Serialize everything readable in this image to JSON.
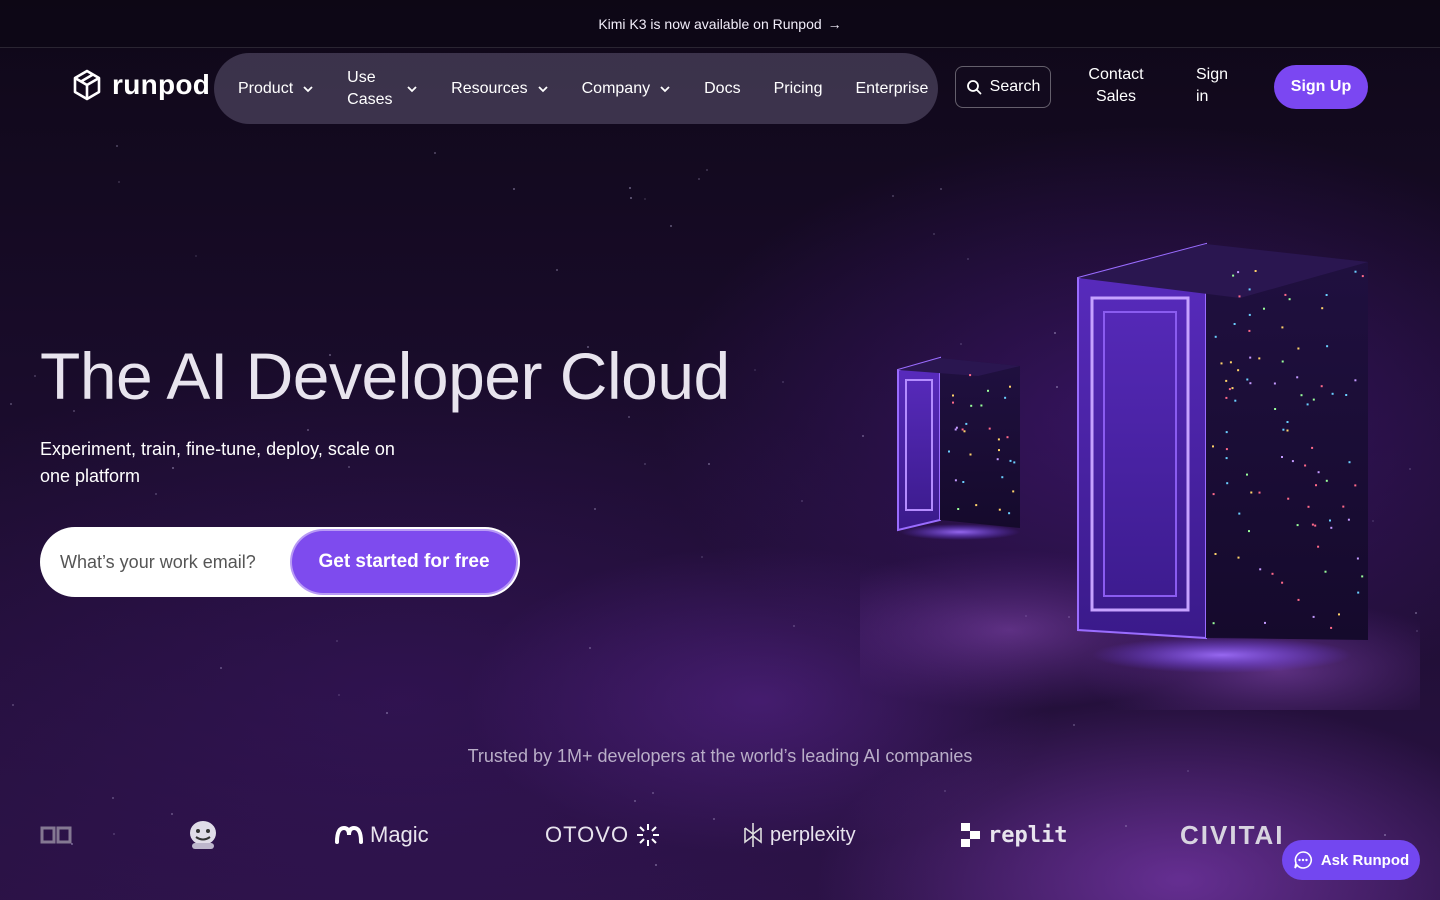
{
  "announcement": {
    "text": "Kimi K3 is now available on Runpod",
    "arrow": "→"
  },
  "header": {
    "logo_text": "runpod",
    "nav": [
      {
        "label": "Product",
        "has_dropdown": true
      },
      {
        "label": "Use Cases",
        "has_dropdown": true
      },
      {
        "label": "Resources",
        "has_dropdown": true
      },
      {
        "label": "Company",
        "has_dropdown": true
      },
      {
        "label": "Docs",
        "has_dropdown": false
      },
      {
        "label": "Pricing",
        "has_dropdown": false
      },
      {
        "label": "Enterprise",
        "has_dropdown": false
      }
    ],
    "search_label": "Search",
    "contact_label": "Contact Sales",
    "signin_label": "Sign in",
    "signup_label": "Sign Up"
  },
  "hero": {
    "title": "The AI Developer Cloud",
    "subtitle": "Experiment, train, fine-tune, deploy, scale on one platform",
    "email_placeholder": "What’s your work email?",
    "cta_label": "Get started for free"
  },
  "trusted": {
    "text": "Trusted by 1M+ developers at the world’s leading AI companies",
    "logos": [
      "Magic",
      "OTOVO",
      "perplexity",
      "replit",
      "CIVITAI"
    ]
  },
  "assistant": {
    "label": "Ask Runpod"
  },
  "colors": {
    "accent": "#7b47f2",
    "background": "#14091f"
  }
}
